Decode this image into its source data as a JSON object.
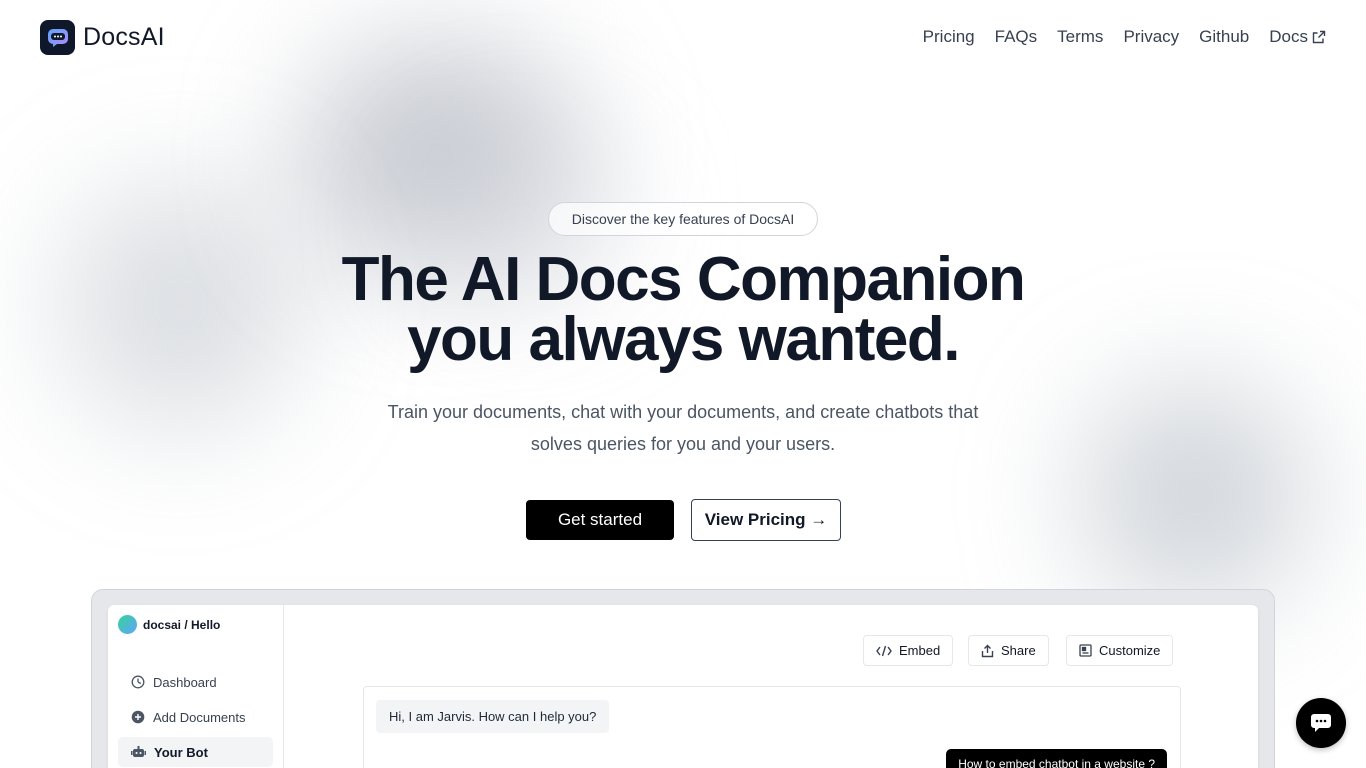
{
  "brand": {
    "name": "DocsAI"
  },
  "nav": {
    "items": [
      "Pricing",
      "FAQs",
      "Terms",
      "Privacy",
      "Github",
      "Docs"
    ]
  },
  "hero": {
    "pill": "Discover the key features of DocsAI",
    "headline_line1": "The AI Docs Companion",
    "headline_line2": "you always wanted.",
    "subhead_line1": "Train your documents, chat with your documents, and create chatbots that",
    "subhead_line2": "solves queries for you and your users.",
    "primary_cta": "Get started",
    "secondary_cta": "View Pricing →"
  },
  "preview": {
    "workspace": "docsai / Hello",
    "sidebar": [
      "Dashboard",
      "Add Documents",
      "Your Bot"
    ],
    "toolbar": {
      "embed": "Embed",
      "share": "Share",
      "customize": "Customize"
    },
    "bot_message": "Hi, I am Jarvis. How can I help you?",
    "user_message": "How to embed chatbot in a website ?"
  },
  "colors": {
    "primary": "#000000",
    "text": "#111827",
    "muted": "#4b5563"
  }
}
